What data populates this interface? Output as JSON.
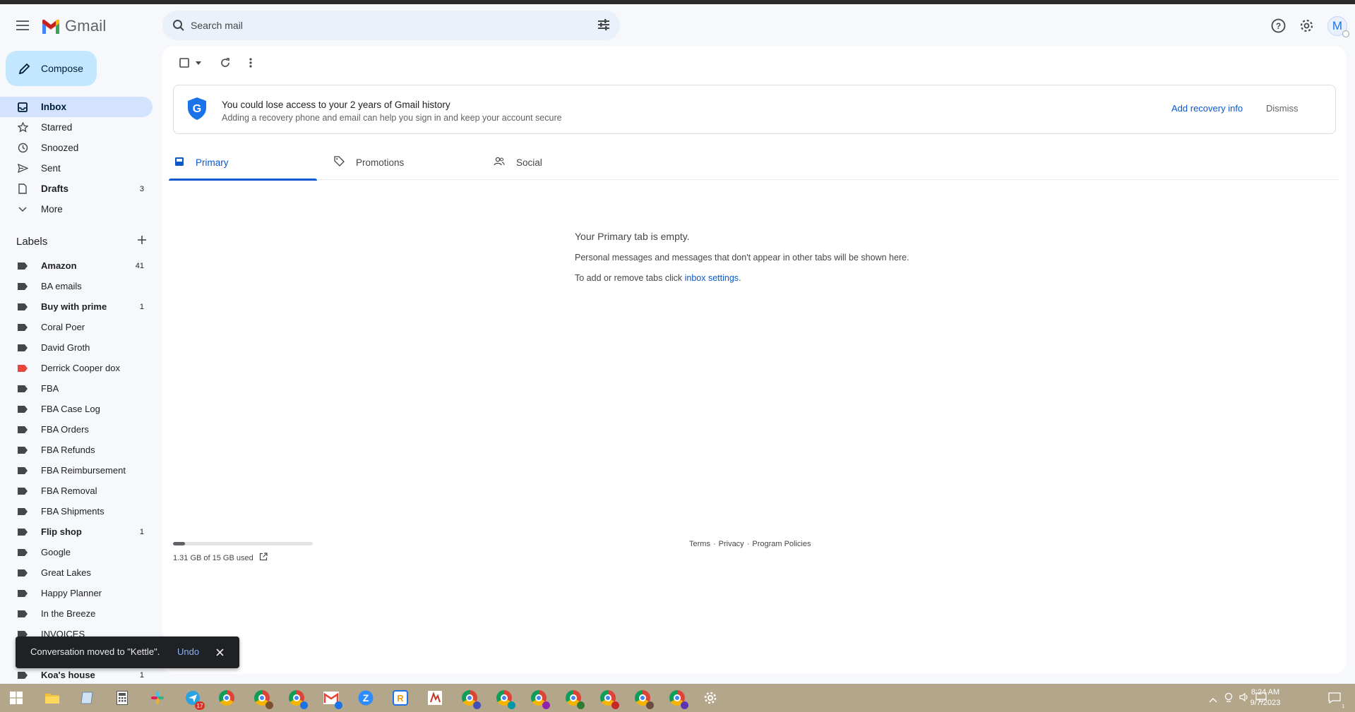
{
  "app": {
    "name": "Gmail"
  },
  "search": {
    "placeholder": "Search mail"
  },
  "header": {
    "avatar_letter": "M"
  },
  "compose": {
    "label": "Compose"
  },
  "nav": {
    "items": [
      {
        "label": "Inbox",
        "count": "",
        "icon": "inbox-icon",
        "active": true
      },
      {
        "label": "Starred",
        "count": "",
        "icon": "star-icon"
      },
      {
        "label": "Snoozed",
        "count": "",
        "icon": "clock-icon"
      },
      {
        "label": "Sent",
        "count": "",
        "icon": "send-icon"
      },
      {
        "label": "Drafts",
        "count": "3",
        "icon": "draft-icon"
      },
      {
        "label": "More",
        "count": "",
        "icon": "chevron-down-icon"
      }
    ]
  },
  "labels": {
    "heading": "Labels",
    "items": [
      {
        "label": "Amazon",
        "count": "41",
        "bold": true,
        "color": "#444746"
      },
      {
        "label": "BA emails",
        "count": "",
        "color": "#444746"
      },
      {
        "label": "Buy with prime",
        "count": "1",
        "bold": true,
        "color": "#444746"
      },
      {
        "label": "Coral Poer",
        "count": "",
        "color": "#444746"
      },
      {
        "label": "David Groth",
        "count": "",
        "color": "#444746"
      },
      {
        "label": "Derrick Cooper dox",
        "count": "",
        "color": "#e8453c"
      },
      {
        "label": "FBA",
        "count": "",
        "color": "#444746"
      },
      {
        "label": "FBA Case Log",
        "count": "",
        "color": "#444746"
      },
      {
        "label": "FBA Orders",
        "count": "",
        "color": "#444746"
      },
      {
        "label": "FBA Refunds",
        "count": "",
        "color": "#444746"
      },
      {
        "label": "FBA Reimbursement",
        "count": "",
        "color": "#444746"
      },
      {
        "label": "FBA Removal",
        "count": "",
        "color": "#444746"
      },
      {
        "label": "FBA Shipments",
        "count": "",
        "color": "#444746"
      },
      {
        "label": "Flip shop",
        "count": "1",
        "bold": true,
        "color": "#444746"
      },
      {
        "label": "Google",
        "count": "",
        "color": "#444746"
      },
      {
        "label": "Great Lakes",
        "count": "",
        "color": "#444746"
      },
      {
        "label": "Happy Planner",
        "count": "",
        "color": "#444746"
      },
      {
        "label": "In the Breeze",
        "count": "",
        "color": "#444746"
      },
      {
        "label": "INVOICES",
        "count": "",
        "color": "#444746"
      },
      {
        "label": "",
        "count": "",
        "color": "#444746"
      },
      {
        "label": "Koa's house",
        "count": "1",
        "bold": true,
        "color": "#444746"
      }
    ]
  },
  "banner": {
    "title": "You could lose access to your 2 years of Gmail history",
    "subtitle": "Adding a recovery phone and email can help you sign in and keep your account secure",
    "add_label": "Add recovery info",
    "dismiss_label": "Dismiss"
  },
  "tabs": [
    {
      "label": "Primary",
      "icon": "inbox-tab-icon",
      "active": true
    },
    {
      "label": "Promotions",
      "icon": "tag-icon"
    },
    {
      "label": "Social",
      "icon": "people-icon"
    }
  ],
  "empty": {
    "title": "Your Primary tab is empty.",
    "body": "Personal messages and messages that don't appear in other tabs will be shown here.",
    "settings_prefix": "To add or remove tabs click ",
    "settings_link": "inbox settings",
    "settings_suffix": "."
  },
  "storage": {
    "text": "1.31 GB of 15 GB used",
    "used_fraction": 0.087
  },
  "footer": {
    "terms": "Terms",
    "privacy": "Privacy",
    "policies": "Program Policies",
    "separator": "·"
  },
  "snackbar": {
    "message": "Conversation moved to \"Kettle\".",
    "undo_label": "Undo"
  },
  "taskbar": {
    "time": "8:24 AM",
    "date": "9/7/2023",
    "mail_badge": "17",
    "notification_count": "1"
  },
  "colors": {
    "accent": "#0b57d0",
    "compose_bg": "#c2e7ff",
    "active_nav_bg": "#d3e3fd",
    "page_bg": "#f6f8fc",
    "taskbar_bg": "#b3a68a"
  }
}
